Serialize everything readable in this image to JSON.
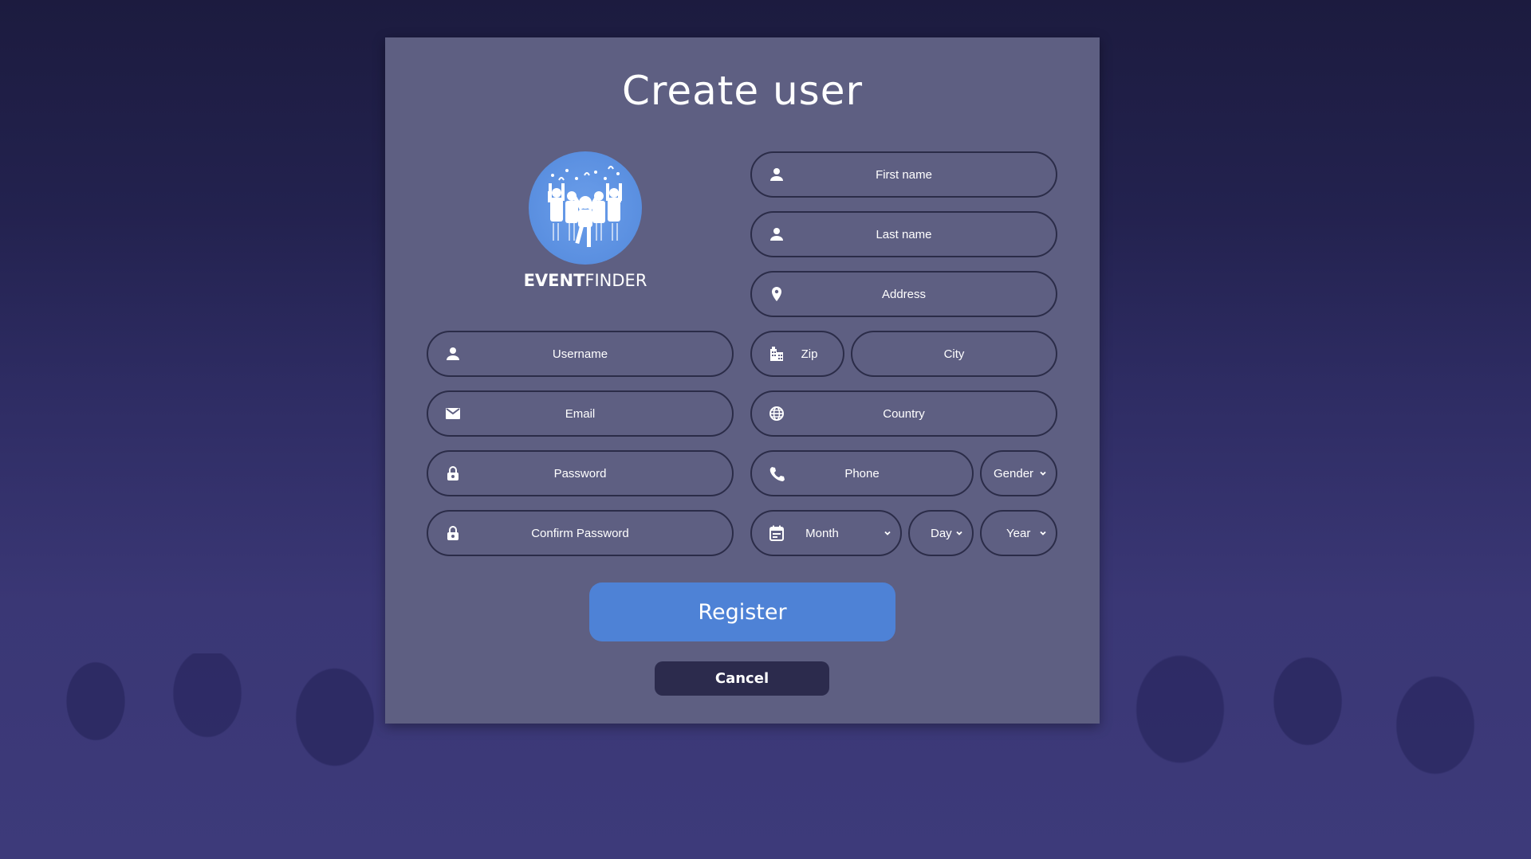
{
  "page": {
    "title": "Create user",
    "brand": {
      "bold": "EVENT",
      "light": "FINDER"
    }
  },
  "form": {
    "username": {
      "placeholder": "Username",
      "icon": "person-icon"
    },
    "email": {
      "placeholder": "Email",
      "icon": "mail-icon"
    },
    "password": {
      "placeholder": "Password",
      "icon": "lock-icon"
    },
    "confirm_password": {
      "placeholder": "Confirm Password",
      "icon": "lock-icon"
    },
    "first_name": {
      "placeholder": "First name",
      "icon": "person-icon"
    },
    "last_name": {
      "placeholder": "Last name",
      "icon": "person-icon"
    },
    "address": {
      "placeholder": "Address",
      "icon": "location-pin-icon"
    },
    "zip": {
      "placeholder": "Zip",
      "icon": "building-icon"
    },
    "city": {
      "placeholder": "City"
    },
    "country": {
      "placeholder": "Country",
      "icon": "globe-icon"
    },
    "phone": {
      "placeholder": "Phone",
      "icon": "phone-icon"
    },
    "gender": {
      "value": "Gender"
    },
    "month": {
      "value": "Month",
      "icon": "calendar-icon"
    },
    "day": {
      "value": "Day"
    },
    "year": {
      "value": "Year"
    }
  },
  "actions": {
    "register_label": "Register",
    "cancel_label": "Cancel"
  },
  "colors": {
    "panel": "#5e5f82",
    "field_border": "#2b2c48",
    "register": "#4e82d6",
    "cancel": "#2c2b4d",
    "logo": "#5a8fe0"
  }
}
